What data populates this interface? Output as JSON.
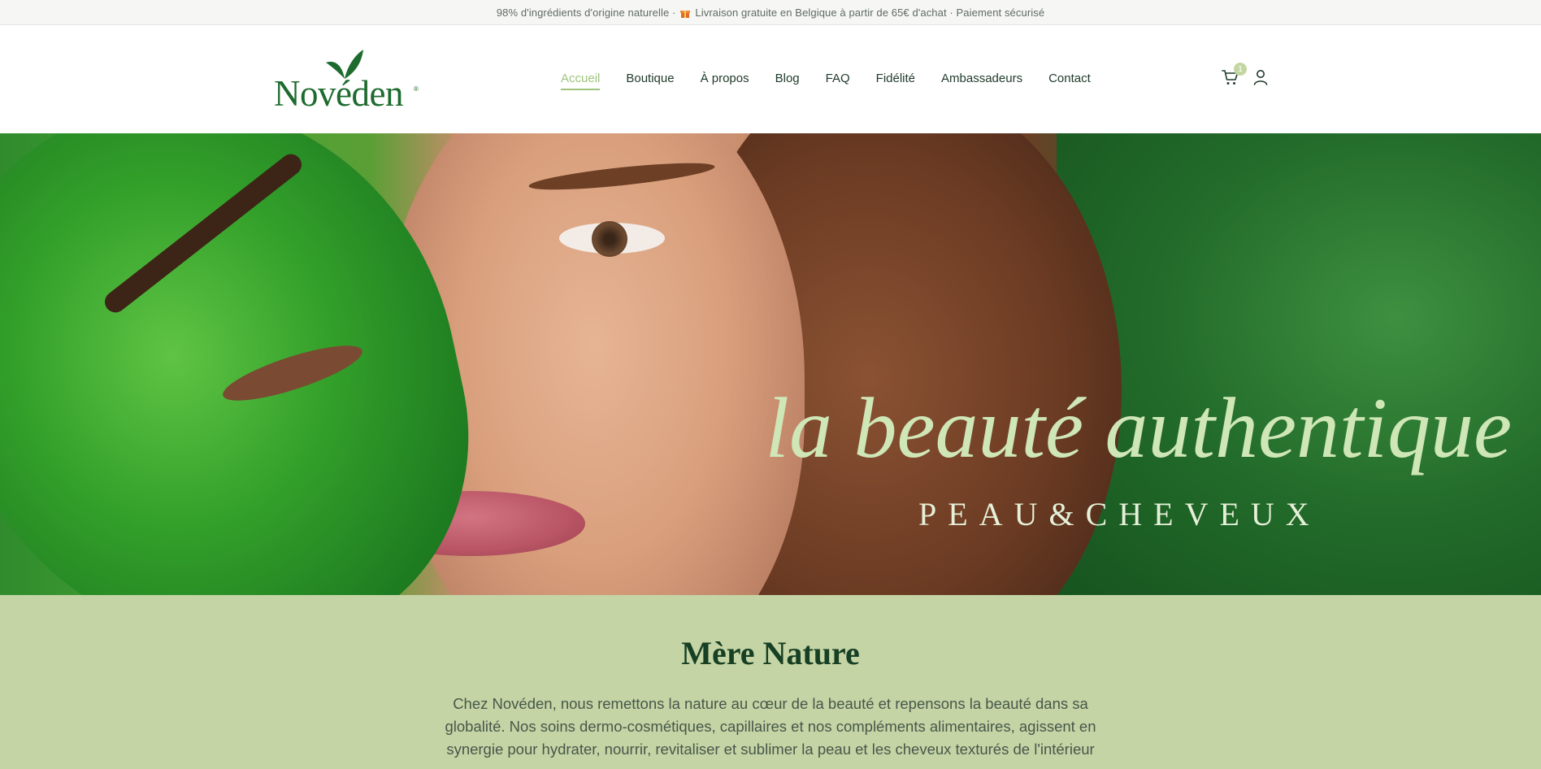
{
  "announcement": {
    "part1": "98% d'ingrédients d'origine naturelle ·",
    "gift_icon": "gift-icon",
    "part2": "Livraison gratuite en Belgique à partir de 65€ d'achat · Paiement sécurisé"
  },
  "brand": {
    "name": "Novéden",
    "reg": "®",
    "color": "#1d6b2e"
  },
  "nav": {
    "items": [
      {
        "label": "Accueil",
        "active": true
      },
      {
        "label": "Boutique"
      },
      {
        "label": "À propos"
      },
      {
        "label": "Blog"
      },
      {
        "label": "FAQ"
      },
      {
        "label": "Fidélité"
      },
      {
        "label": "Ambassadeurs"
      },
      {
        "label": "Contact"
      }
    ],
    "active_color": "#9ec47f"
  },
  "header_icons": {
    "cart_icon": "cart-icon",
    "cart_count": "1",
    "user_icon": "user-icon"
  },
  "hero": {
    "title": "la beauté authentique",
    "subtitle": "PEAU&CHEVEUX",
    "title_color": "#cfe6b6"
  },
  "intro": {
    "heading": "Mère Nature",
    "text": "Chez Novéden, nous remettons la nature au cœur de la beauté et repensons la beauté dans sa globalité. Nos soins dermo-cosmétiques, capillaires et nos compléments alimentaires, agissent en synergie pour hydrater, nourrir, revitaliser et sublimer la peau et les cheveux texturés de l'intérieur",
    "background": "#c4d4a5"
  }
}
